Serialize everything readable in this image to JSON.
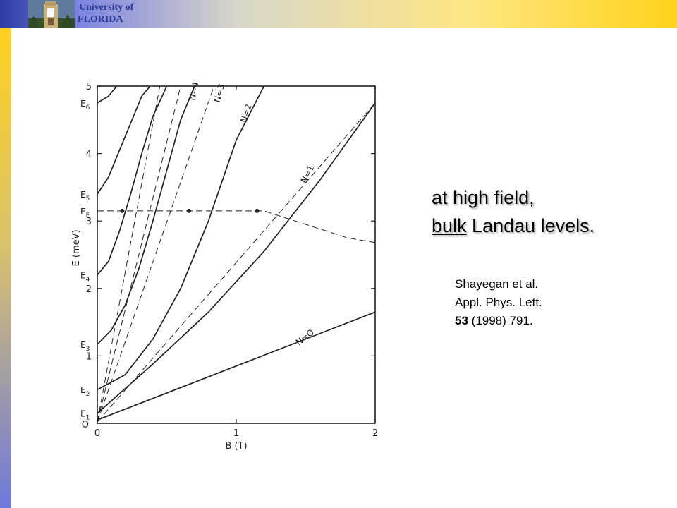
{
  "header": {
    "logo_line1": "University of",
    "logo_line2": "FLORIDA",
    "accent_blue": "#2a3a99",
    "accent_gold": "#ffd21a"
  },
  "headline": {
    "line1": "at high field,",
    "line2_underlined": "bulk",
    "line2_rest": "Landau levels."
  },
  "citation": {
    "line1": "Shayegan et al.",
    "line2": "Appl. Phys. Lett.",
    "line3_volume": "53",
    "line3_rest": "(1998) 791."
  },
  "chart_data": {
    "type": "line",
    "xlabel": "B (T)",
    "ylabel": "E (meV)",
    "xlim": [
      0,
      2
    ],
    "ylim": [
      0,
      5
    ],
    "x_ticks": [
      "0",
      "1",
      "2"
    ],
    "y_ticks": [
      "1",
      "2",
      "3",
      "4",
      "5"
    ],
    "origin_label": "O",
    "subband_labels": [
      {
        "label": "E1",
        "y": 0.15
      },
      {
        "label": "E2",
        "y": 0.5
      },
      {
        "label": "E3",
        "y": 1.17
      },
      {
        "label": "E4",
        "y": 2.2
      },
      {
        "label": "E5",
        "y": 3.4
      },
      {
        "label": "EF",
        "y": 3.15
      },
      {
        "label": "E6",
        "y": 4.75
      }
    ],
    "fermi_energy": 3.15,
    "fermi_markers_x": [
      0.18,
      0.66,
      1.15
    ],
    "series": [
      {
        "name": "N=O",
        "style": "solid",
        "x": [
          0,
          2
        ],
        "y": [
          0.05,
          1.65
        ]
      },
      {
        "name": "N=1",
        "style": "solid",
        "x": [
          0,
          0.4,
          0.8,
          1.2,
          1.6,
          2.0
        ],
        "y": [
          0.15,
          0.88,
          1.65,
          2.55,
          3.6,
          4.75
        ]
      },
      {
        "name": "N=1",
        "style": "dashed",
        "x": [
          0,
          2
        ],
        "y": [
          0.02,
          4.75
        ]
      },
      {
        "name": "N=2",
        "style": "solid",
        "x": [
          0,
          0.2,
          0.4,
          0.6,
          0.8,
          1.0,
          1.2
        ],
        "y": [
          0.5,
          0.72,
          1.25,
          2.0,
          3.0,
          4.2,
          5.0
        ]
      },
      {
        "name": "N=2",
        "style": "dashed",
        "x": [
          0,
          0.84
        ],
        "y": [
          0.02,
          5.0
        ]
      },
      {
        "name": "N=3",
        "style": "solid",
        "x": [
          0,
          0.1,
          0.2,
          0.3,
          0.4,
          0.5,
          0.6,
          0.7
        ],
        "y": [
          1.17,
          1.38,
          1.75,
          2.3,
          3.0,
          3.75,
          4.5,
          5.0
        ]
      },
      {
        "name": "N=3",
        "style": "dashed",
        "x": [
          0,
          0.6
        ],
        "y": [
          0.02,
          5.0
        ]
      },
      {
        "name": "N=4",
        "style": "solid",
        "x": [
          0,
          0.08,
          0.16,
          0.24,
          0.32,
          0.4,
          0.5
        ],
        "y": [
          2.2,
          2.4,
          2.85,
          3.4,
          4.0,
          4.55,
          5.0
        ]
      },
      {
        "name": "N=4",
        "style": "dashed",
        "x": [
          0,
          0.45
        ],
        "y": [
          0.02,
          5.0
        ]
      },
      {
        "name": "",
        "style": "solid",
        "x": [
          0,
          0.08,
          0.16,
          0.24,
          0.32,
          0.38
        ],
        "y": [
          3.4,
          3.65,
          4.05,
          4.45,
          4.85,
          5.0
        ]
      },
      {
        "name": "",
        "style": "solid",
        "x": [
          0,
          0.08,
          0.14
        ],
        "y": [
          4.75,
          4.85,
          5.0
        ]
      },
      {
        "name": "",
        "style": "dashed",
        "x": [
          0,
          1.2,
          1.5,
          1.8,
          2.0
        ],
        "y": [
          3.15,
          3.15,
          2.95,
          2.75,
          2.68
        ]
      }
    ],
    "curve_labels": [
      {
        "text": "N=O",
        "x": 1.45,
        "y": 1.15,
        "angle": -38
      },
      {
        "text": "N=1",
        "x": 1.5,
        "y": 3.55,
        "angle": -63
      },
      {
        "text": "N=2",
        "x": 1.07,
        "y": 4.45,
        "angle": -72
      },
      {
        "text": "N=3",
        "x": 0.88,
        "y": 4.75,
        "angle": -75
      },
      {
        "text": "N=4",
        "x": 0.7,
        "y": 4.78,
        "angle": -78
      }
    ],
    "grid": false
  }
}
